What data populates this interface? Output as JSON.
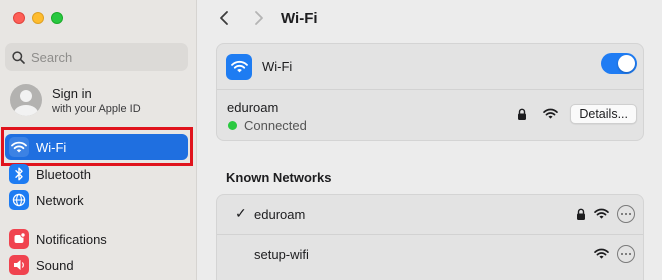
{
  "window": {
    "title": "Wi-Fi"
  },
  "sidebar": {
    "search_placeholder": "Search",
    "account": {
      "line1": "Sign in",
      "line2": "with your Apple ID"
    },
    "items": [
      {
        "label": "Wi-Fi",
        "icon": "wifi-icon",
        "color": "#1e7cf2",
        "selected": true
      },
      {
        "label": "Bluetooth",
        "icon": "bluetooth-icon",
        "color": "#1e7cf2"
      },
      {
        "label": "Network",
        "icon": "globe-icon",
        "color": "#1e7cf2"
      },
      {
        "label": "Notifications",
        "icon": "bell-icon",
        "color": "#f0434f"
      },
      {
        "label": "Sound",
        "icon": "speaker-icon",
        "color": "#f0434f"
      }
    ]
  },
  "main": {
    "title": "Wi-Fi",
    "wifi_label": "Wi-Fi",
    "wifi_enabled": true,
    "current_network": {
      "name": "eduroam",
      "status": "Connected",
      "details_label": "Details..."
    },
    "known_title": "Known Networks",
    "known_networks": [
      {
        "name": "eduroam",
        "connected": true,
        "secured": true
      },
      {
        "name": "setup-wifi",
        "connected": false,
        "secured": false
      }
    ]
  },
  "colors": {
    "accent": "#1f6fe0",
    "highlight_frame": "#e0131c",
    "connected": "#2ac940"
  }
}
